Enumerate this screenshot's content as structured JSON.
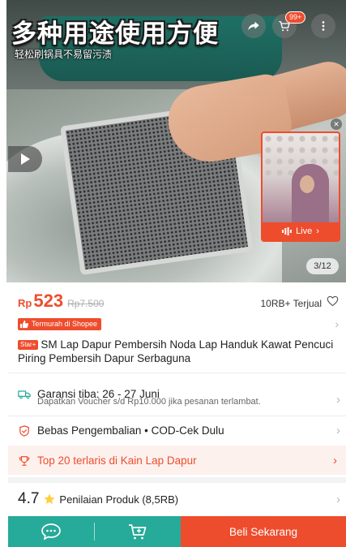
{
  "hero": {
    "title": "多种用途使用方便",
    "subtitle": "轻松刷锅具不易留污渍",
    "cart_badge": "99+",
    "live_label": "Live",
    "page_counter": "3/12"
  },
  "product": {
    "currency": "Rp",
    "price": "523",
    "old_price": "Rp7.500",
    "sold": "10RB+ Terjual",
    "cheap_badge": "Termurah di Shopee",
    "star_badge": "Star+",
    "title": "SM Lap Dapur Pembersih Noda Lap Handuk Kawat Pencuci Piring Pembersih Dapur Serbaguna"
  },
  "shipping": {
    "guarantee": "Garansi tiba: 26 - 27 Juni",
    "voucher_note": "Dapatkan Voucher s/d Rp10.000 jika pesanan terlambat."
  },
  "returns": {
    "label": "Bebas Pengembalian  •  COD-Cek Dulu"
  },
  "ranking": {
    "label": "Top 20 terlaris di Kain Lap Dapur"
  },
  "rating": {
    "score": "4.7",
    "label": "Penilaian Produk (8,5RB)"
  },
  "bottom_bar": {
    "buy_label": "Beli Sekarang"
  },
  "icons": {
    "chevron": "›"
  },
  "colors": {
    "accent": "#ee4d2d",
    "teal": "#26aa99"
  }
}
